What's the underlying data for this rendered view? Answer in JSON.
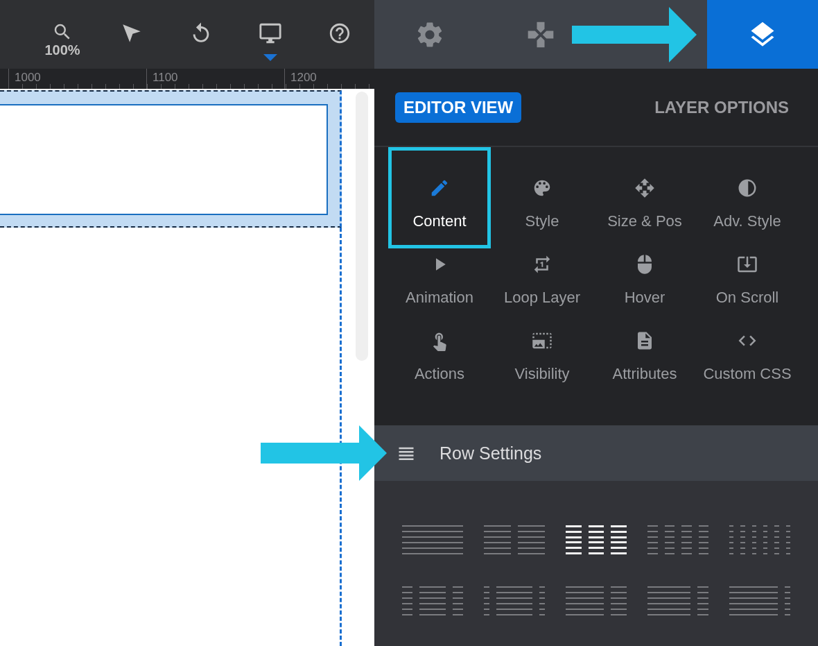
{
  "toolbar": {
    "tools": [
      {
        "kind": "zoom",
        "label": "100%",
        "selected": false
      },
      {
        "kind": "select",
        "selected": false
      },
      {
        "kind": "undo",
        "selected": false
      },
      {
        "kind": "device",
        "selected": true
      },
      {
        "kind": "help",
        "selected": false
      }
    ]
  },
  "ruler": {
    "labels": [
      "1000",
      "1100",
      "1200"
    ]
  },
  "panel_tabs": [
    {
      "kind": "settings",
      "selected": false
    },
    {
      "kind": "navigation",
      "selected": false
    },
    {
      "kind": "layers",
      "selected": true
    }
  ],
  "view_tabs": [
    {
      "label": "EDITOR VIEW",
      "selected": true
    },
    {
      "label": "LAYER OPTIONS",
      "selected": false
    }
  ],
  "tools": [
    {
      "label": "Content",
      "selected": true
    },
    {
      "label": "Style",
      "selected": false
    },
    {
      "label": "Size & Pos",
      "selected": false
    },
    {
      "label": "Adv. Style",
      "selected": false
    },
    {
      "label": "Animation",
      "selected": false
    },
    {
      "label": "Loop Layer",
      "selected": false
    },
    {
      "label": "Hover",
      "selected": false
    },
    {
      "label": "On Scroll",
      "selected": false
    },
    {
      "label": "Actions",
      "selected": false
    },
    {
      "label": "Visibility",
      "selected": false
    },
    {
      "label": "Attributes",
      "selected": false
    },
    {
      "label": "Custom CSS",
      "selected": false
    }
  ],
  "row_settings": {
    "title": "Row Settings"
  },
  "layout_presets": [
    {
      "kind": "full",
      "selected": false
    },
    {
      "kind": "halves",
      "selected": false
    },
    {
      "kind": "thirds",
      "selected": true
    },
    {
      "kind": "quarters",
      "selected": false
    },
    {
      "kind": "sixths",
      "selected": false
    },
    {
      "kind": "quarter-half-quarter",
      "selected": false
    },
    {
      "kind": "narrow-wide-narrow",
      "selected": false
    },
    {
      "kind": "two-thirds-third",
      "selected": false
    },
    {
      "kind": "four-fifths-fifth",
      "selected": false
    },
    {
      "kind": "wide-narrow",
      "selected": false
    }
  ]
}
